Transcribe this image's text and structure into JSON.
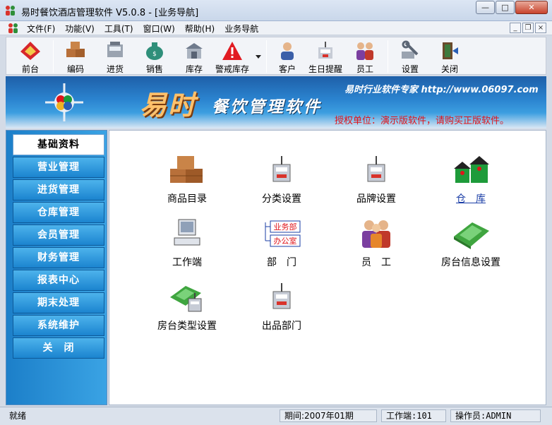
{
  "window": {
    "title": "易时餐饮酒店管理软件 V5.0.8 - [业务导航]",
    "minimize": "—",
    "maximize": "□",
    "close": "✕"
  },
  "menubar": {
    "items": [
      "文件(F)",
      "功能(V)",
      "工具(T)",
      "窗口(W)",
      "帮助(H)",
      "业务导航"
    ],
    "mdi": [
      "_",
      "❐",
      "×"
    ]
  },
  "toolbar": {
    "buttons": [
      "前台",
      "编码",
      "进货",
      "销售",
      "库存",
      "警戒库存",
      "客户",
      "生日提醒",
      "员工",
      "设置",
      "关闭"
    ]
  },
  "banner": {
    "brand_big": "易时",
    "brand_sub": "餐饮管理软件",
    "slogan": "易时行业软件专家 http://www.06097.com",
    "auth": "授权单位：演示版软件，请购买正版软件。"
  },
  "nav": {
    "items": [
      "基础资料",
      "营业管理",
      "进货管理",
      "仓库管理",
      "会员管理",
      "财务管理",
      "报表中心",
      "期末处理",
      "系统维护",
      "关　闭"
    ],
    "active": 0
  },
  "tiles": [
    "商品目录",
    "分类设置",
    "品牌设置",
    "仓　库",
    "工作端",
    "部　门",
    "员　工",
    "房台信息设置",
    "房台类型设置",
    "出品部门"
  ],
  "org_chart": {
    "top": "业务部",
    "bottom": "办公室"
  },
  "status": {
    "ready": "就绪",
    "period": "期间:2007年01期",
    "workstation": "工作端:101",
    "operator": "操作员:ADMIN"
  },
  "colors": {
    "nav_blue": "#1b84cf",
    "banner_red": "#e0141a",
    "brand_orange": "#ffc16b"
  }
}
